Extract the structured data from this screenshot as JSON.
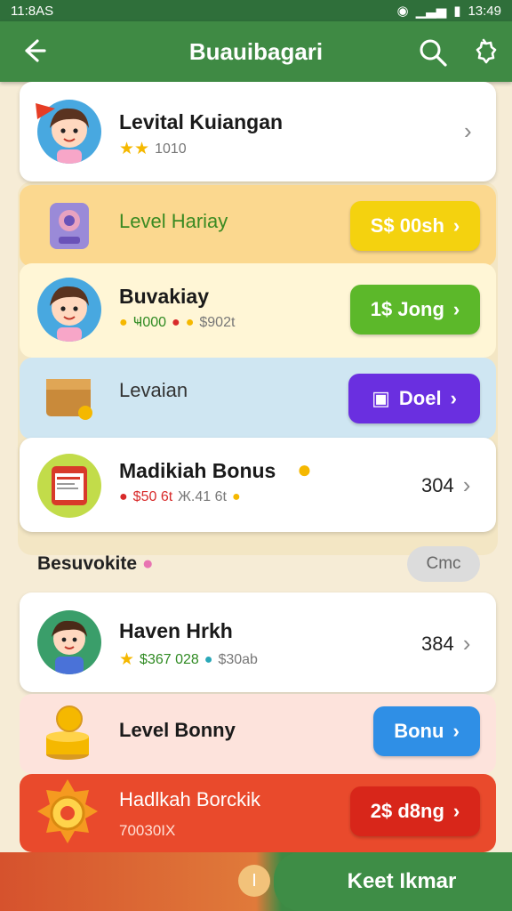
{
  "status": {
    "time": "11:8AS",
    "right": "13:49"
  },
  "appbar": {
    "title": "Buauibagari"
  },
  "rows": [
    {
      "title": "Levital Kuiangan",
      "sub": "1010"
    },
    {
      "title": "Level Hariay",
      "button": "S$ 00sh"
    },
    {
      "title": "Buvakiay",
      "sub1": "Ҹ000",
      "sub2": "$902t",
      "button": "1$ Jong"
    },
    {
      "title": "Levaian",
      "button": "Doel"
    },
    {
      "title": "Madikiah Bonus",
      "sub1": "$50 6t",
      "sub2": "Ж.41 6t",
      "value": "304"
    }
  ],
  "section": {
    "title": "Besuvokite",
    "more": "Cmc"
  },
  "rows2": [
    {
      "title": "Haven Hrkh",
      "sub1": "$367 028",
      "sub2": "$30ab",
      "value": "384"
    },
    {
      "title": "Level Bonny",
      "button": "Bonu"
    },
    {
      "title": "Hadlkah Borckik",
      "sub": "70030IX",
      "button": "2$ d8ng"
    }
  ],
  "bottom": {
    "label": "Keet Ikmar",
    "dot": "I"
  },
  "colors": {
    "green": "#3f8a44",
    "yellow": "#f4d20f",
    "lime": "#5cb82a",
    "purple": "#6a2fe0",
    "blue": "#2f8fe6",
    "red": "#e63d25"
  }
}
